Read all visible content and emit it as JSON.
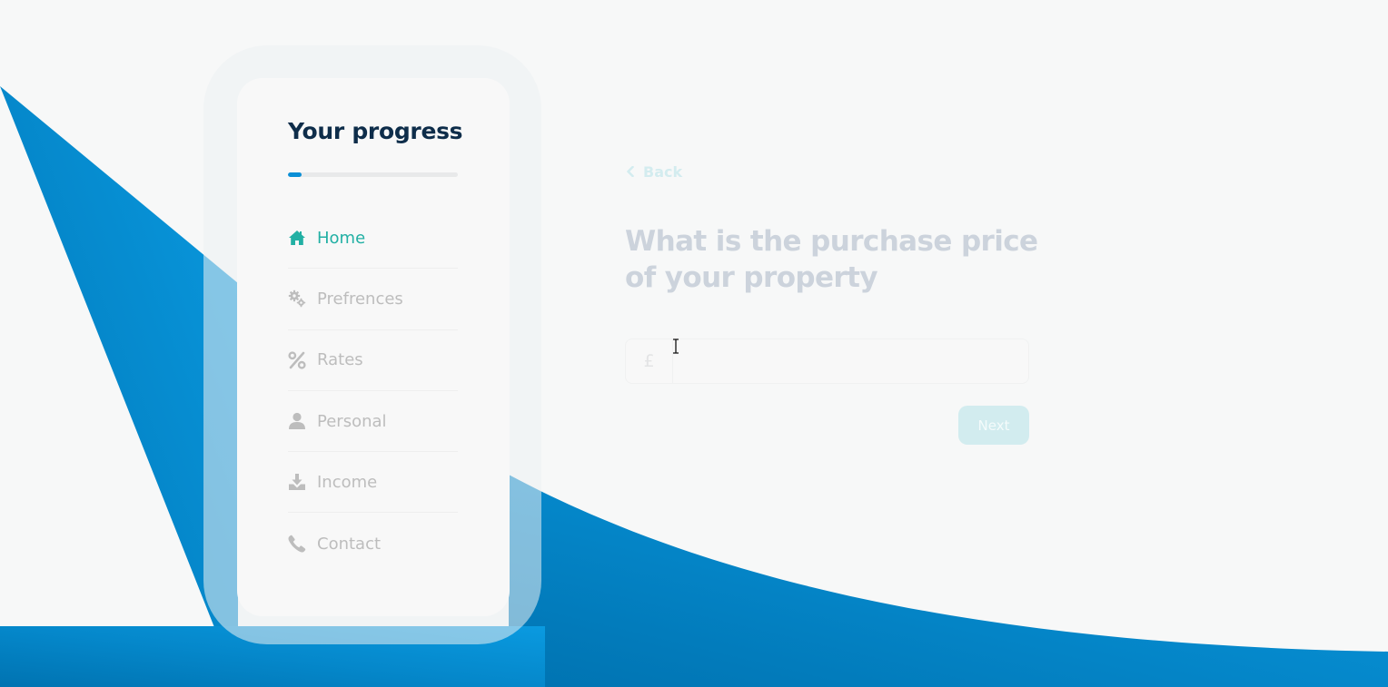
{
  "sidebar": {
    "title": "Your progress",
    "progress_fraction": 0.08,
    "items": [
      {
        "label": "Home",
        "icon": "home-icon",
        "active": true
      },
      {
        "label": "Prefrences",
        "icon": "cogs-icon",
        "active": false
      },
      {
        "label": "Rates",
        "icon": "percent-icon",
        "active": false
      },
      {
        "label": "Personal",
        "icon": "user-icon",
        "active": false
      },
      {
        "label": "Income",
        "icon": "download-icon",
        "active": false
      },
      {
        "label": "Contact",
        "icon": "phone-icon",
        "active": false
      }
    ]
  },
  "main": {
    "back_label": "Back",
    "question": "What is the purchase price of your property",
    "price_field": {
      "currency_symbol": "£",
      "value": "",
      "placeholder": ""
    },
    "next_label": "Next"
  },
  "colors": {
    "brand_blue": "#0a8fd6",
    "active_teal": "#22b0a4",
    "heading_navy": "#0e2d4a",
    "inactive_gray": "#bdbdbd"
  }
}
